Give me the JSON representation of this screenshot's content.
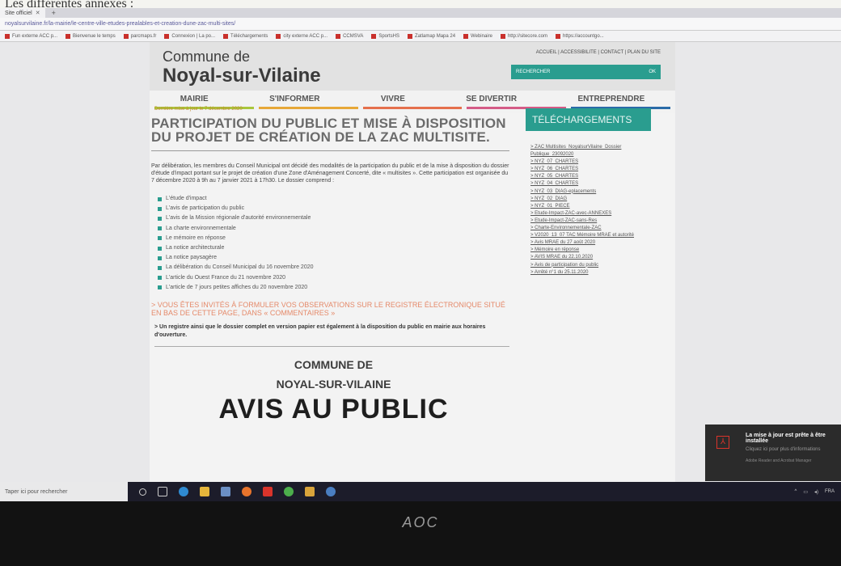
{
  "caption": "Les différentes annexes :",
  "browser": {
    "tab_label": "Site officiel",
    "url": "noyalsurvilaine.fr/la-mairie/le-centre-ville-etudes-prealables-et-creation-dune-zac-multi-sites/",
    "bookmarks": [
      "Fun externe ACC p...",
      "Bienvenue le temps",
      "parcmaps.fr",
      "Connexion | La po...",
      "Téléchargements",
      "city externe ACC p...",
      "CCMSVA",
      "SportsHS",
      "Zatlamap Mapa 24",
      "Webinaire",
      "http://sitecore.com",
      "https://accountgo..."
    ]
  },
  "site": {
    "logo_small": "Commune de",
    "logo_big": "Noyal-sur-Vilaine",
    "top_links": "ACCUEIL | ACCESSIBILITE | CONTACT | PLAN DU SITE",
    "search_label": "RECHERCHER",
    "search_button": "OK",
    "nav": [
      {
        "label": "MAIRIE",
        "color": "#a9c63c"
      },
      {
        "label": "S'INFORMER",
        "color": "#e7a838"
      },
      {
        "label": "VIVRE",
        "color": "#e5704d"
      },
      {
        "label": "SE DIVERTIR",
        "color": "#d45b86"
      },
      {
        "label": "ENTREPRENDRE",
        "color": "#2a6ba8"
      }
    ],
    "updated": "Dernière mise à jour le 7 décembre 2020",
    "title": "PARTICIPATION DU PUBLIC ET MISE À DISPOSITION DU PROJET DE CRÉATION DE LA ZAC MULTISITE.",
    "intro": "Par délibération, les membres du Conseil Municipal ont décidé des modalités de la participation du public et de la mise à disposition du dossier d'étude d'impact portant sur le projet de création d'une Zone d'Aménagement Concerté, dite « multisites ». Cette participation est organisée du 7 décembre 2020 à 9h au 7 janvier 2021 à 17h30. Le dossier comprend :",
    "documents": [
      "L'étude d'impact",
      "L'avis de participation du public",
      "L'avis de la Mission régionale d'autorité environnementale",
      "La charte environnementale",
      "Le mémoire en réponse",
      "La notice architecturale",
      "La notice paysagère",
      "La délibération du Conseil Municipal du 16 novembre 2020",
      "L'article du Ouest France du 21 novembre 2020",
      "L'article de 7 jours petites affiches du 20 novembre 2020"
    ],
    "invite": "> VOUS ÊTES INVITÉS À FORMULER VOS OBSERVATIONS SUR LE REGISTRE ÉLECTRONIQUE SITUÉ EN BAS DE CETTE PAGE, DANS « COMMENTAIRES »",
    "note": "> Un registre ainsi que le dossier complet en version papier est également à la disposition du public en mairie aux horaires d'ouverture.",
    "avis_line1": "COMMUNE DE",
    "avis_line2": "NOYAL-SUR-VILAINE",
    "avis_line3": "AVIS AU PUBLIC",
    "sidebar_title": "TÉLÉCHARGEMENTS",
    "downloads": [
      "> ZAC Multisites_NoyalsurVilaine_Dossier",
      "Publique_23092020",
      "> NYZ_07_CHARTES",
      "> NYZ_06_CHARTES",
      "> NYZ_05_CHARTES",
      "> NYZ_04_CHARTES",
      "> NYZ_03_DIAG-eplacements",
      "> NYZ_02_DIAG",
      "> NYZ_01_PIECE",
      "> Etude-Impact-ZAC-avec-ANNEXES",
      "> Etude-Impact-ZAC-sans-Res",
      "> Charte-Environnementale-ZAC",
      "> V2020_13_07 TAC Mémoire MRAE et autorité",
      "> Avis MRAE du 27 août 2020",
      "> Mémoire en réponse",
      "> AVIS MRAE du 22.10.2020",
      "> Avis de participation du public",
      "> Arrêté n°1 du 25.11.2020"
    ]
  },
  "toast": {
    "title": "La mise à jour est prête à être installée",
    "body": "Cliquez ici pour plus d'informations",
    "foot": "Adobe Reader and Acrobat Manager"
  },
  "taskbar": {
    "search": "Taper ici pour rechercher",
    "lang": "FRA"
  },
  "monitor_brand": "AOC"
}
